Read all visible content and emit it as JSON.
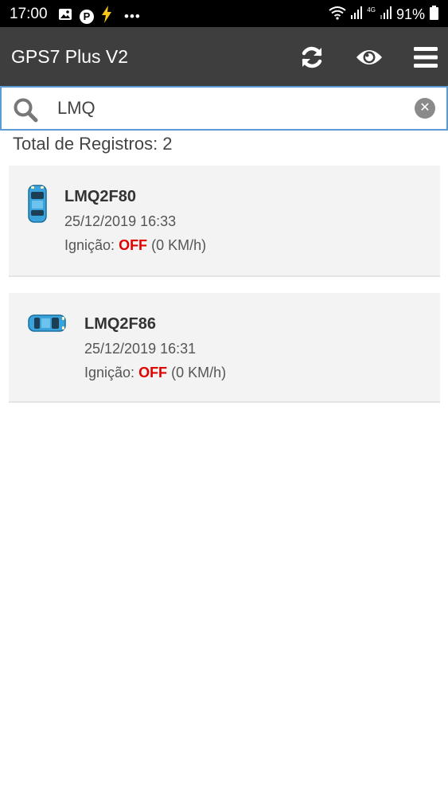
{
  "status_bar": {
    "time": "17:00",
    "battery": "91%",
    "overflow": "•••",
    "network": "4G"
  },
  "header": {
    "title": "GPS7 Plus V2",
    "icons": [
      "refresh-icon",
      "eye-icon",
      "menu-icon"
    ]
  },
  "search": {
    "value": "LMQ",
    "placeholder": ""
  },
  "summary": {
    "total_label": "Total de Registros: 2"
  },
  "vehicles": [
    {
      "plate": "LMQ2F80",
      "datetime": "25/12/2019 16:33",
      "ignition_label": "Ignição:",
      "ignition_state": "OFF",
      "speed": "(0 KM/h)",
      "icon": "car-top-vertical-icon"
    },
    {
      "plate": "LMQ2F86",
      "datetime": "25/12/2019 16:31",
      "ignition_label": "Ignição:",
      "ignition_state": "OFF",
      "speed": "(0 KM/h)",
      "icon": "car-top-horizontal-icon"
    }
  ],
  "colors": {
    "header_bg": "#3e3e3e",
    "status_off": "#e00000",
    "search_border": "#5b9bd5",
    "card_bg": "#f3f3f3",
    "car_blue": "#3aa3dc"
  }
}
